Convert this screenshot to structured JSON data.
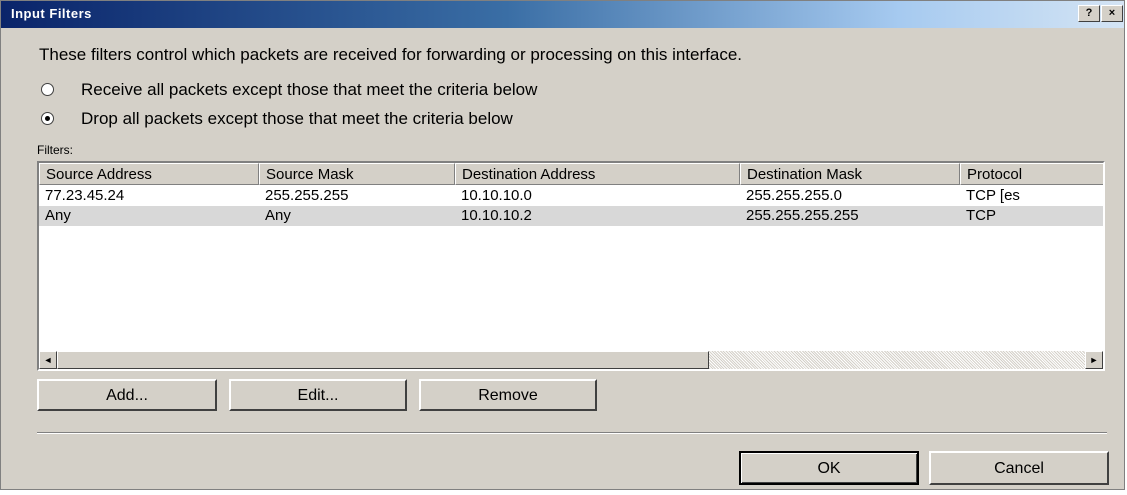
{
  "window": {
    "title": "Input Filters",
    "help_label": "?",
    "close_label": "×"
  },
  "description": "These filters control which packets are received for forwarding or processing on this interface.",
  "radios": [
    {
      "label": "Receive all packets except those that meet the criteria below",
      "checked": false
    },
    {
      "label": "Drop all packets except those that meet the criteria below",
      "checked": true
    }
  ],
  "filters_label": "Filters:",
  "table": {
    "columns": [
      "Source Address",
      "Source Mask",
      "Destination Address",
      "Destination Mask",
      "Protocol"
    ],
    "rows": [
      [
        "77.23.45.24",
        "255.255.255",
        "10.10.10.0",
        "255.255.255.0",
        "TCP [es"
      ],
      [
        "Any",
        "Any",
        "10.10.10.2",
        "255.255.255.255",
        "TCP"
      ]
    ]
  },
  "scrollbar": {
    "left_arrow": "◄",
    "right_arrow": "►"
  },
  "buttons": {
    "add": "Add...",
    "edit": "Edit...",
    "remove": "Remove",
    "ok": "OK",
    "cancel": "Cancel"
  }
}
